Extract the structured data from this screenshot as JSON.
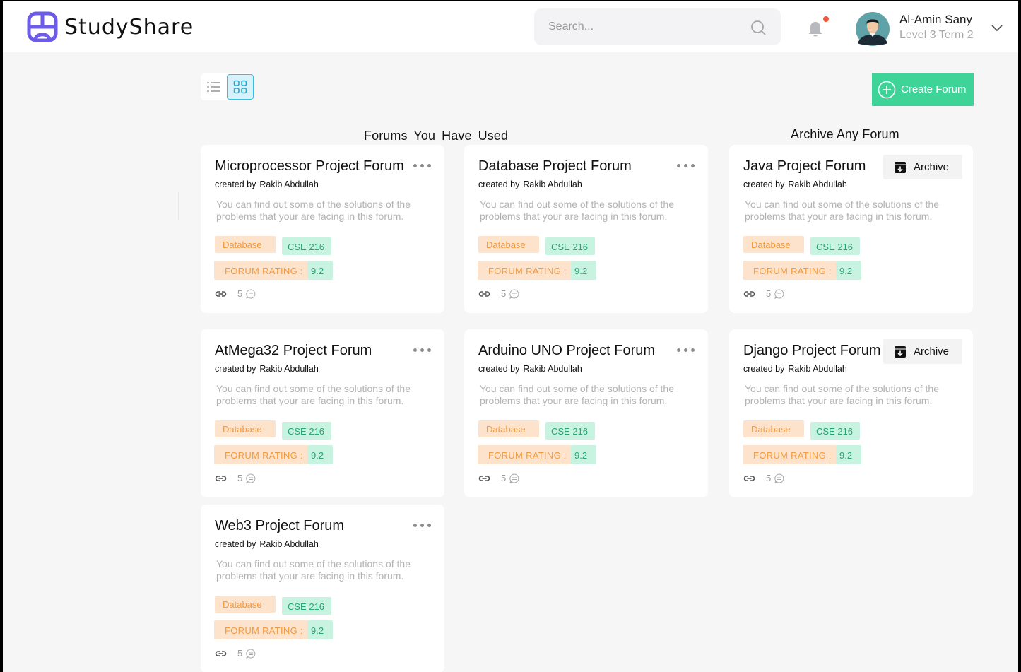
{
  "app": {
    "name": "StudyShare",
    "brand_color": "#6c5ce7",
    "accent_green": "#3ed497"
  },
  "header": {
    "search_placeholder": "Search...",
    "notification_icon": "bell-icon",
    "has_unread_notification": true,
    "user": {
      "name": "Al-Amin Sany",
      "level": "Level 3 Term 2"
    }
  },
  "toolbar": {
    "view_modes": [
      "list-view-icon",
      "grid-view-icon"
    ],
    "active_view": "grid",
    "create_button_label": "Create Forum"
  },
  "sections": {
    "used_title": "Forums  You Have Used",
    "archive_title": "Archive Any Forum"
  },
  "forums": [
    {
      "title": "Microprocessor Project Forum",
      "created_label": "created by",
      "creator": "Rakib Abdullah",
      "description": "You can find out some of the solutions of the problems  that your are facing in this forum.",
      "tag": "Database",
      "course": "CSE 216",
      "rating_label": "FORUM RATING :",
      "rating": "9.2",
      "comments": "5",
      "action": "menu"
    },
    {
      "title": "Database Project Forum",
      "created_label": "created by",
      "creator": "Rakib Abdullah",
      "description": "You can find out some of the solutions of the problems  that your are facing in this forum.",
      "tag": "Database",
      "course": "CSE 216",
      "rating_label": "FORUM RATING :",
      "rating": "9.2",
      "comments": "5",
      "action": "menu"
    },
    {
      "title": "Java Project Forum",
      "created_label": "created by",
      "creator": "Rakib Abdullah",
      "description": "You can find out some of the solutions of the problems  that your are facing in this forum.",
      "tag": "Database",
      "course": "CSE 216",
      "rating_label": "FORUM RATING :",
      "rating": "9.2",
      "comments": "5",
      "action": "archive",
      "archive_label": "Archive"
    },
    {
      "title": "AtMega32 Project Forum",
      "created_label": "created by",
      "creator": "Rakib Abdullah",
      "description": "You can find out some of the solutions of the problems  that your are facing in this forum.",
      "tag": "Database",
      "course": "CSE 216",
      "rating_label": "FORUM RATING :",
      "rating": "9.2",
      "comments": "5",
      "action": "menu"
    },
    {
      "title": "Arduino UNO Project Forum",
      "created_label": "created by",
      "creator": "Rakib Abdullah",
      "description": "You can find out some of the solutions of the problems  that your are facing in this forum.",
      "tag": "Database",
      "course": "CSE 216",
      "rating_label": "FORUM RATING :",
      "rating": "9.2",
      "comments": "5",
      "action": "menu"
    },
    {
      "title": "Django Project Forum",
      "created_label": "created by",
      "creator": "Rakib Abdullah",
      "description": "You can find out some of the solutions of the problems  that your are facing in this forum.",
      "tag": "Database",
      "course": "CSE 216",
      "rating_label": "FORUM RATING :",
      "rating": "9.2",
      "comments": "5",
      "action": "archive",
      "archive_label": "Archive"
    },
    {
      "title": "Web3 Project Forum",
      "created_label": "created by",
      "creator": "Rakib Abdullah",
      "description": "You can find out some of the solutions of the problems  that your are facing in this forum.",
      "tag": "Database",
      "course": "CSE 216",
      "rating_label": "FORUM RATING :",
      "rating": "9.2",
      "comments": "5",
      "action": "menu"
    }
  ]
}
